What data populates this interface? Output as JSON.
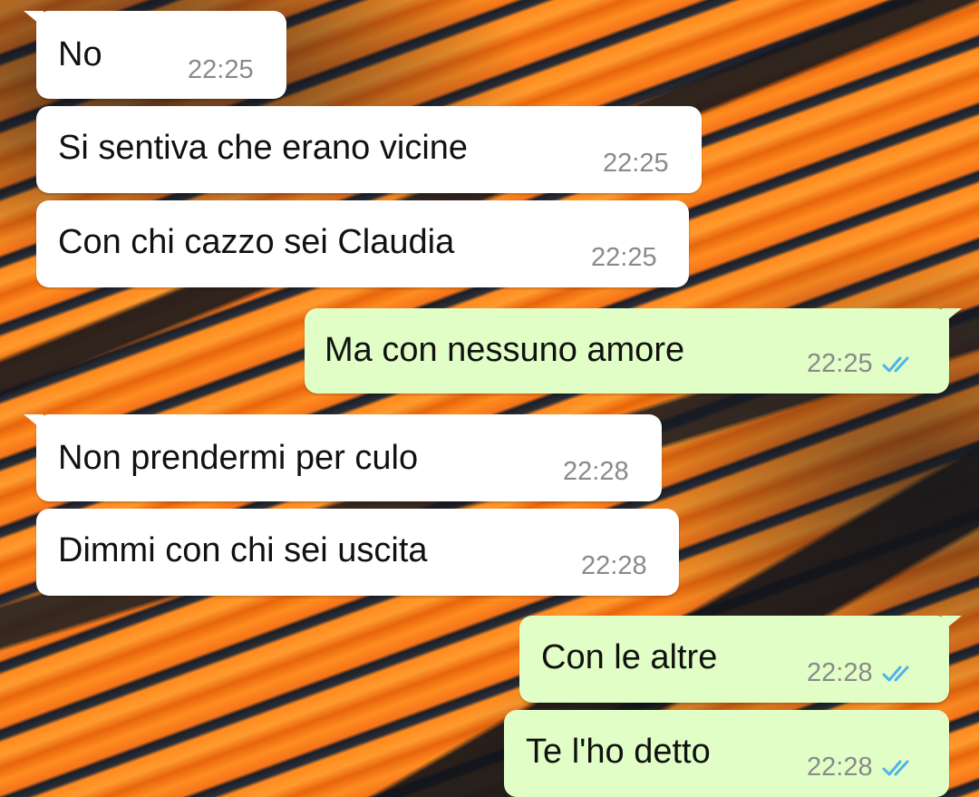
{
  "chat": {
    "messages": [
      {
        "direction": "in",
        "text": "No",
        "time": "22:25"
      },
      {
        "direction": "in",
        "text": "Si sentiva che erano vicine",
        "time": "22:25"
      },
      {
        "direction": "in",
        "text": "Con chi cazzo sei Claudia",
        "time": "22:25"
      },
      {
        "direction": "out",
        "text": "Ma con nessuno amore",
        "time": "22:25",
        "status": "read"
      },
      {
        "direction": "in",
        "text": "Non prendermi per culo",
        "time": "22:28"
      },
      {
        "direction": "in",
        "text": "Dimmi con chi sei uscita",
        "time": "22:28"
      },
      {
        "direction": "out",
        "text": "Con le altre",
        "time": "22:28",
        "status": "read"
      },
      {
        "direction": "out",
        "text": "Te l'ho detto",
        "time": "22:28",
        "status": "read"
      }
    ]
  },
  "colors": {
    "incoming_bubble": "#ffffff",
    "outgoing_bubble": "#e1fec6",
    "read_ticks": "#4fb3e8",
    "timestamp": "#8a8a8a"
  },
  "icons": {
    "read_status": "double-check-icon"
  }
}
